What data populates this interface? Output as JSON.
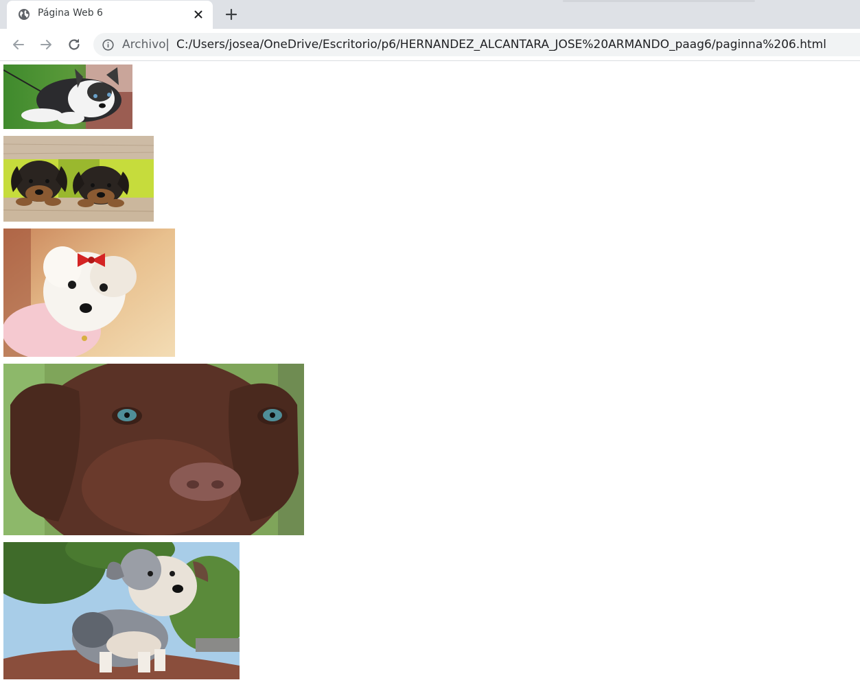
{
  "browser": {
    "tab": {
      "title": "Página Web 6",
      "icon": "globe-icon"
    },
    "new_tab_icon": "plus-icon",
    "close_icon": "close-icon",
    "nav": {
      "back_icon": "back-arrow-icon",
      "forward_icon": "forward-arrow-icon",
      "reload_icon": "reload-icon"
    },
    "address_bar": {
      "info_icon": "info-icon",
      "scheme_label": "Archivo",
      "separator": "|",
      "url": "C:/Users/josea/OneDrive/Escritorio/p6/HERNANDEZ_ALCANTARA_JOSE%20ARMANDO_paag6/paginna%206.html"
    }
  },
  "page": {
    "images": [
      {
        "name": "husky-puppy-image",
        "subject": "husky puppy lying on grass"
      },
      {
        "name": "rottweiler-puppies-image",
        "subject": "two rottweiler puppies behind wooden fence"
      },
      {
        "name": "maltese-puppy-image",
        "subject": "white maltese puppy with red bow and pink sweater"
      },
      {
        "name": "chocolate-lab-puppy-image",
        "subject": "chocolate labrador puppy close-up"
      },
      {
        "name": "aussie-puppy-image",
        "subject": "australian shepherd puppy outdoors"
      }
    ]
  },
  "colors": {
    "tabstrip": "#dee1e6",
    "omnibox": "#f1f3f4",
    "icon": "#5f6368"
  }
}
